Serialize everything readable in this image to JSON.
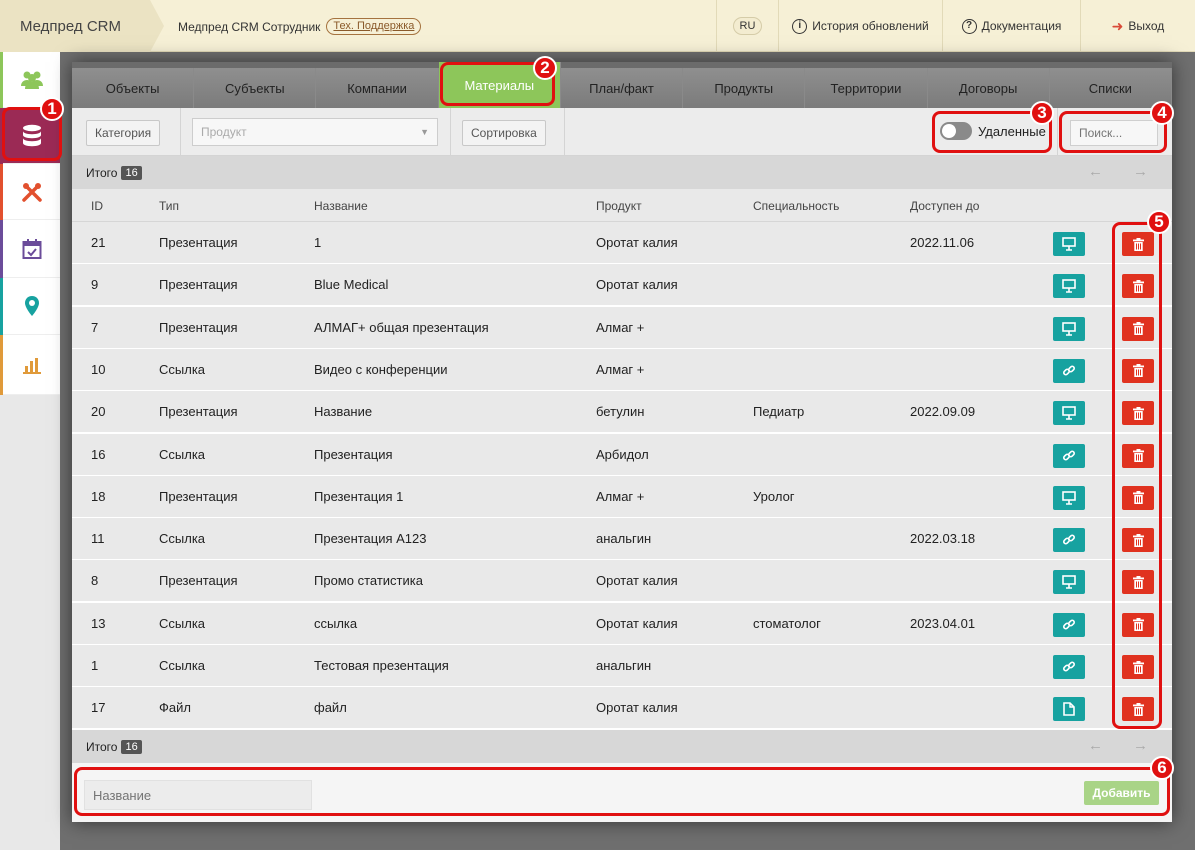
{
  "header": {
    "brand": "Медпред CRM",
    "user": "Медпред CRM Сотрудник",
    "support": "Тех. Поддержка",
    "lang": "RU",
    "history": "История обновлений",
    "docs": "Документация",
    "logout": "Выход"
  },
  "sidebar": {
    "items": [
      {
        "icon": "users-icon",
        "color": "#8dc65a"
      },
      {
        "icon": "database-icon",
        "color": "#9b2a55"
      },
      {
        "icon": "tools-icon",
        "color": "#e2502e"
      },
      {
        "icon": "calendar-check-icon",
        "color": "#6b4c9a"
      },
      {
        "icon": "map-marker-icon",
        "color": "#17a2a0"
      },
      {
        "icon": "bar-chart-icon",
        "color": "#e09a3a"
      }
    ]
  },
  "tabs": [
    "Объекты",
    "Субъекты",
    "Компании",
    "Материалы",
    "План/факт",
    "Продукты",
    "Территории",
    "Договоры",
    "Списки"
  ],
  "active_tab": "Материалы",
  "filters": {
    "category": "Категория",
    "product_placeholder": "Продукт",
    "sort": "Сортировка",
    "deleted": "Удаленные",
    "search_placeholder": "Поиск..."
  },
  "totals": {
    "label": "Итого",
    "count": "16"
  },
  "columns": {
    "id": "ID",
    "type": "Тип",
    "name": "Название",
    "product": "Продукт",
    "specialty": "Специальность",
    "until": "Доступен до"
  },
  "rows": [
    {
      "id": "21",
      "type": "Презентация",
      "name": "1",
      "product": "Оротат калия",
      "specialty": "",
      "until": "2022.11.06",
      "action": "presentation-icon"
    },
    {
      "id": "9",
      "type": "Презентация",
      "name": "Blue Medical",
      "product": "Оротат калия",
      "specialty": "",
      "until": "",
      "action": "presentation-icon"
    },
    {
      "id": "7",
      "type": "Презентация",
      "name": "АЛМАГ+ общая презентация",
      "product": "Алмаг +",
      "specialty": "",
      "until": "",
      "action": "presentation-icon"
    },
    {
      "id": "10",
      "type": "Ссылка",
      "name": "Видео с конференции",
      "product": "Алмаг +",
      "specialty": "",
      "until": "",
      "action": "link-icon"
    },
    {
      "id": "20",
      "type": "Презентация",
      "name": "Название",
      "product": "бетулин",
      "specialty": "Педиатр",
      "until": "2022.09.09",
      "action": "presentation-icon"
    },
    {
      "id": "16",
      "type": "Ссылка",
      "name": "Презентация",
      "product": "Арбидол",
      "specialty": "",
      "until": "",
      "action": "link-icon"
    },
    {
      "id": "18",
      "type": "Презентация",
      "name": "Презентация 1",
      "product": "Алмаг +",
      "specialty": "Уролог",
      "until": "",
      "action": "presentation-icon"
    },
    {
      "id": "11",
      "type": "Ссылка",
      "name": "Презентация А123",
      "product": "анальгин",
      "specialty": "",
      "until": "2022.03.18",
      "action": "link-icon"
    },
    {
      "id": "8",
      "type": "Презентация",
      "name": "Промо статистика",
      "product": "Оротат калия",
      "specialty": "",
      "until": "",
      "action": "presentation-icon"
    },
    {
      "id": "13",
      "type": "Ссылка",
      "name": "ссылка",
      "product": "Оротат калия",
      "specialty": "стоматолог",
      "until": "2023.04.01",
      "action": "link-icon"
    },
    {
      "id": "1",
      "type": "Ссылка",
      "name": "Тестовая презентация",
      "product": "анальгин",
      "specialty": "",
      "until": "",
      "action": "link-icon"
    },
    {
      "id": "17",
      "type": "Файл",
      "name": "файл",
      "product": "Оротат калия",
      "specialty": "",
      "until": "",
      "action": "file-icon"
    }
  ],
  "add_form": {
    "name_placeholder": "Название",
    "add_label": "Добавить"
  },
  "callouts": [
    "1",
    "2",
    "3",
    "4",
    "5",
    "6"
  ],
  "colors": {
    "accent_green": "#8dc65a",
    "teal": "#17a2a0",
    "delete_red": "#e0321f",
    "callout_red": "#e01010"
  }
}
